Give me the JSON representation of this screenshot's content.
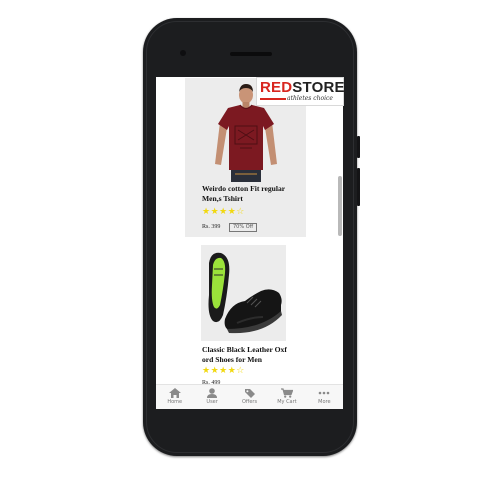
{
  "app": {
    "logo": {
      "part1": "RED",
      "part2": "STORE",
      "tagline": "athletes choice"
    }
  },
  "products": [
    {
      "title_line1": "Weirdo cotton Fit regular",
      "title_line2": "Men,s Tshirt",
      "rating": 4,
      "stars_text": "★★★★☆",
      "price": "Rs. 399",
      "discount": "70% Off",
      "image_icon": "red-tshirt-model-photo",
      "shirt_color": "#7c1921"
    },
    {
      "title_line1": "Classic Black Leather Oxf",
      "title_line2": "ord Shoes for Men",
      "rating": 4,
      "stars_text": "★★★★☆",
      "price": "Rs. 499",
      "discount": "",
      "image_icon": "black-sneakers-photo",
      "insole_color": "#9be23a"
    }
  ],
  "nav": [
    {
      "label": "Home",
      "icon": "home-icon"
    },
    {
      "label": "User",
      "icon": "user-icon"
    },
    {
      "label": "Offers",
      "icon": "tag-icon"
    },
    {
      "label": "My Cart",
      "icon": "cart-icon"
    },
    {
      "label": "More",
      "icon": "more-icon"
    }
  ],
  "colors": {
    "brand_red": "#d8261f",
    "star": "#f1d80f",
    "nav_icon": "#8a8a8a"
  }
}
